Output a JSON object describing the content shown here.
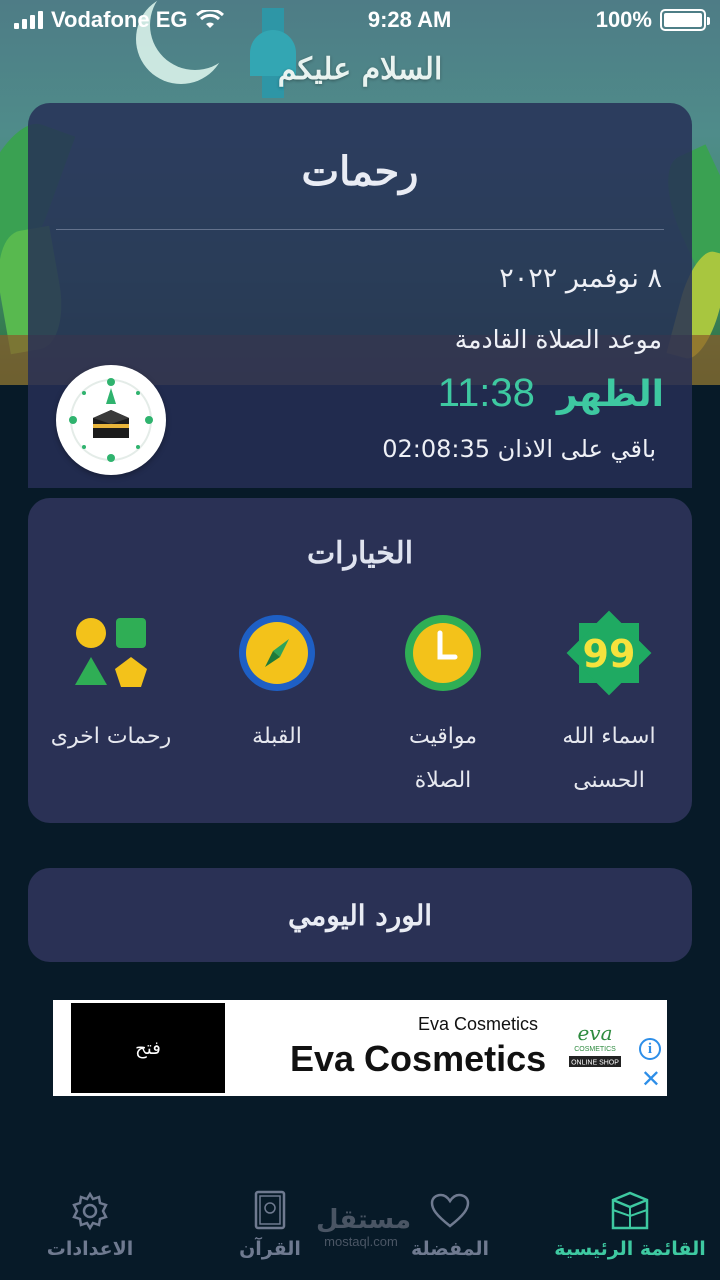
{
  "status_bar": {
    "carrier": "Vodafone EG",
    "time": "9:28 AM",
    "battery": "100%"
  },
  "greeting": "السلام عليكم",
  "main_card": {
    "app_name": "رحمات",
    "date": "٨ نوفمبر ٢٠٢٢",
    "next_prayer_label": "موعد الصلاة القادمة",
    "next_prayer_name": "الظهر",
    "next_prayer_time": "11:38",
    "remaining_text": "باقي على الاذان 02:08:35"
  },
  "options": {
    "title": "الخيارات",
    "items": [
      {
        "label_line1": "اسماء الله",
        "label_line2": "الحسنى",
        "icon": "asma-allah-99-icon"
      },
      {
        "label_line1": "مواقيت",
        "label_line2": "الصلاة",
        "icon": "prayer-times-clock-icon"
      },
      {
        "label_line1": "القبلة",
        "label_line2": "",
        "icon": "qibla-compass-icon"
      },
      {
        "label_line1": "رحمات اخرى",
        "label_line2": "",
        "icon": "more-shapes-icon"
      }
    ]
  },
  "daily_wird": {
    "label": "الورد اليومي"
  },
  "ad": {
    "button_label": "فتح",
    "small_title": "Eva Cosmetics",
    "big_title": "Eva Cosmetics",
    "logo_text": "eva",
    "logo_sub": "COSMETICS",
    "logo_tag": "ONLINE SHOP",
    "info_icon": "i",
    "close_icon": "✕"
  },
  "bottom_nav": {
    "items": [
      {
        "label": "الاعدادات",
        "icon": "gear-icon",
        "active": false
      },
      {
        "label": "القرآن",
        "icon": "quran-book-icon",
        "active": false
      },
      {
        "label": "المفضلة",
        "icon": "heart-icon",
        "active": false
      },
      {
        "label": "القائمة الرئيسية",
        "icon": "kaaba-home-icon",
        "active": true
      }
    ]
  },
  "watermark": {
    "line1": "مستقل",
    "line2": "mostaql.com"
  },
  "colors": {
    "accent": "#3ec9a1",
    "card": "#2a3155",
    "background": "#071a28"
  }
}
